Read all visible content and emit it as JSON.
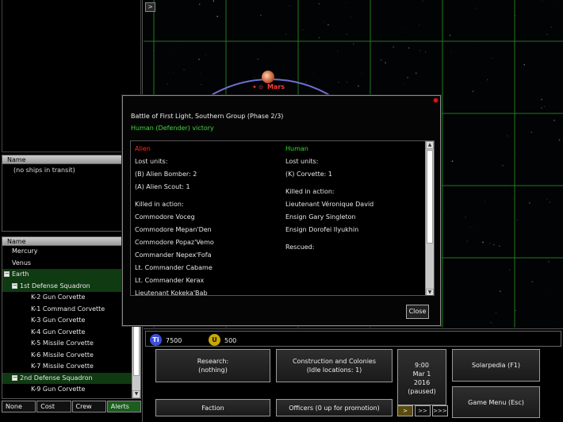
{
  "map": {
    "toggle_label": ">",
    "planet_name": "Mars",
    "planet_icons": "✦ ⊙"
  },
  "left": {
    "transit_header": "Name",
    "transit_empty": "(no ships in transit)",
    "tree_header": "Name",
    "tree": [
      {
        "label": "Mercury",
        "indent": 1,
        "green": false,
        "box": ""
      },
      {
        "label": "Venus",
        "indent": 1,
        "green": false,
        "box": ""
      },
      {
        "label": "Earth",
        "indent": 0,
        "green": true,
        "box": "−"
      },
      {
        "label": "1st Defense Squadron",
        "indent": 1,
        "green": true,
        "box": "−"
      },
      {
        "label": "K-2 Gun Corvette",
        "indent": 3,
        "green": false,
        "box": ""
      },
      {
        "label": "K-1 Command Corvette",
        "indent": 3,
        "green": false,
        "box": ""
      },
      {
        "label": "K-3 Gun Corvette",
        "indent": 3,
        "green": false,
        "box": ""
      },
      {
        "label": "K-4 Gun Corvette",
        "indent": 3,
        "green": false,
        "box": ""
      },
      {
        "label": "K-5 Missile Corvette",
        "indent": 3,
        "green": false,
        "box": ""
      },
      {
        "label": "K-6 Missile Corvette",
        "indent": 3,
        "green": false,
        "box": ""
      },
      {
        "label": "K-7 Missile Corvette",
        "indent": 3,
        "green": false,
        "box": ""
      },
      {
        "label": "2nd Defense Squadron",
        "indent": 1,
        "green": true,
        "box": "−"
      },
      {
        "label": "K-9 Gun Corvette",
        "indent": 3,
        "green": false,
        "box": ""
      }
    ],
    "tabs": [
      "None",
      "Cost",
      "Crew",
      "Alerts"
    ]
  },
  "dialog": {
    "title": "Battle of First Light, Southern Group (Phase 2/3)",
    "result": "Human (Defender) victory",
    "alien": {
      "side": "Alien",
      "lost_units_hdr": "Lost units:",
      "lost_units": [
        "(B) Alien Bomber: 2",
        "(A) Alien Scout: 1"
      ],
      "kia_hdr": "Killed in action:",
      "kia": [
        "Commodore Voceg",
        "Commodore Mepan'Den",
        "Commodore Popaz'Vemo",
        "Commander Nepex'Fofa",
        "Lt. Commander Cabame",
        "Lt. Commander Kerax",
        "Lieutenant Kokeka'Bab"
      ]
    },
    "human": {
      "side": "Human",
      "lost_units_hdr": "Lost units:",
      "lost_units": [
        "(K) Corvette: 1"
      ],
      "kia_hdr": "Killed in action:",
      "kia": [
        "Lieutenant Véronique David",
        "Ensign Gary Singleton",
        "Ensign Dorofei Ilyukhin"
      ],
      "rescued_hdr": "Rescued:"
    },
    "close_label": "Close"
  },
  "bottom": {
    "ti_icon": "Ti",
    "ti_value": "7500",
    "u_icon": "U",
    "u_value": "500",
    "research_line1": "Research:",
    "research_line2": "(nothing)",
    "construction_line1": "Construction and Colonies",
    "construction_line2": "(Idle locations: 1)",
    "time": "9:00",
    "date": "Mar 1",
    "year": "2016",
    "paused": "(paused)",
    "solarpedia": "Solarpedia (F1)",
    "faction": "Faction",
    "officers": "Officers (0 up for promotion)",
    "game_menu": "Game Menu (Esc)",
    "speed": [
      ">",
      ">>",
      ">>>"
    ]
  },
  "colors": {
    "grid": "#1f7a1f",
    "orbit": "#6f6fd0",
    "alien": "#ff2a2a",
    "human": "#2ee02e",
    "ti_icon": "#3b4fd8",
    "u_icon": "#c8a800"
  }
}
